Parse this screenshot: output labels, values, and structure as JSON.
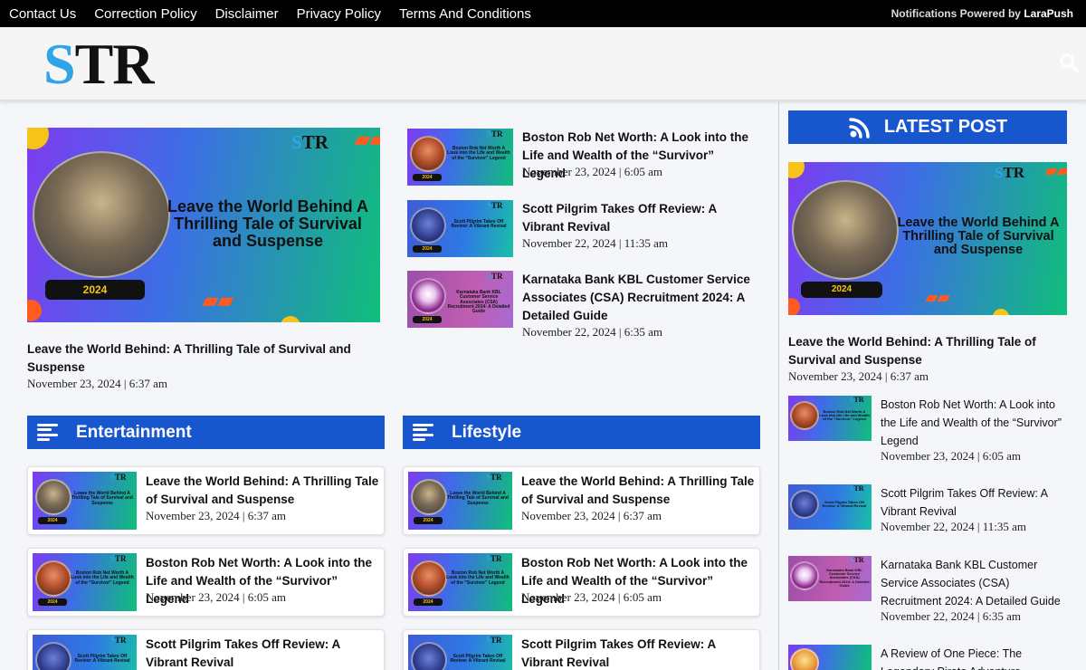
{
  "top_nav": [
    "Contact Us",
    "Correction Policy",
    "Disclaimer",
    "Privacy Policy",
    "Terms And Conditions"
  ],
  "notifications": {
    "prefix": "Notifications Powered by",
    "brand": "LaraPush"
  },
  "logo": {
    "s": "S",
    "rest": "TR"
  },
  "thumbnail": {
    "brand_s": "S",
    "brand_rest": "TR",
    "year": "2024",
    "leave_title": "Leave the World Behind A Thrilling Tale of Survival and Suspense",
    "boston_title": "Boston Rob Net Worth A Look into the Life and Wealth of the “Survivor” Legend",
    "scott_title": "Scott Pilgrim Takes Off Review: A Vibrant Revival",
    "karnataka_title": "Karnataka Bank KBL Customer Service Associates (CSA) Recruitment 2024: A Detailed Guide",
    "karnataka_logo_text": "Karnataka Bank"
  },
  "featured": {
    "title": "Leave the World Behind: A Thrilling Tale of Survival and Suspense",
    "date": "November 23, 2024 | 6:37 am"
  },
  "top_list": [
    {
      "title": "Boston Rob Net Worth: A Look into the Life and Wealth of the “Survivor” Legend",
      "date": "November 23, 2024 | 6:05 am"
    },
    {
      "title": "Scott Pilgrim Takes Off Review: A Vibrant Revival",
      "date": "November 22, 2024 | 11:35 am"
    },
    {
      "title": "Karnataka Bank KBL Customer Service Associates (CSA) Recruitment 2024: A Detailed Guide",
      "date": "November 22, 2024 | 6:35 am"
    }
  ],
  "sections": {
    "entertainment": {
      "label": "Entertainment",
      "items": [
        {
          "title": "Leave the World Behind: A Thrilling Tale of Survival and Suspense",
          "date": "November 23, 2024 | 6:37 am"
        },
        {
          "title": "Boston Rob Net Worth: A Look into the Life and Wealth of the “Survivor” Legend",
          "date": "November 23, 2024 | 6:05 am"
        },
        {
          "title": "Scott Pilgrim Takes Off Review: A Vibrant Revival",
          "date": ""
        }
      ]
    },
    "lifestyle": {
      "label": "Lifestyle",
      "items": [
        {
          "title": "Leave the World Behind: A Thrilling Tale of Survival and Suspense",
          "date": "November 23, 2024 | 6:37 am"
        },
        {
          "title": "Boston Rob Net Worth: A Look into the Life and Wealth of the “Survivor” Legend",
          "date": "November 23, 2024 | 6:05 am"
        },
        {
          "title": "Scott Pilgrim Takes Off Review: A Vibrant Revival",
          "date": ""
        }
      ]
    }
  },
  "latest": {
    "label": "LATEST POST",
    "featured": {
      "title": "Leave the World Behind: A Thrilling Tale of Survival and Suspense",
      "date": "November 23, 2024 | 6:37 am"
    },
    "items": [
      {
        "title": "Boston Rob Net Worth: A Look into the Life and Wealth of the “Survivor” Legend",
        "date": "November 23, 2024 | 6:05 am"
      },
      {
        "title": "Scott Pilgrim Takes Off Review: A Vibrant Revival",
        "date": "November 22, 2024 | 11:35 am"
      },
      {
        "title": "Karnataka Bank KBL Customer Service Associates (CSA) Recruitment 2024: A Detailed Guide",
        "date": "November 22, 2024 | 6:35 am"
      },
      {
        "title": "A Review of One Piece: The Legendary Pirate Adventure",
        "date": ""
      }
    ]
  },
  "icons": {
    "search": "search-icon",
    "menu": "menu-lines-icon",
    "latest": "rss-feed-icon"
  },
  "colors": {
    "accent": "#1856ce",
    "logo_blue": "#2fa5e8",
    "topbar": "#000000",
    "thumb_purple": "#7d3cf0",
    "thumb_green": "#0fbf7a"
  }
}
